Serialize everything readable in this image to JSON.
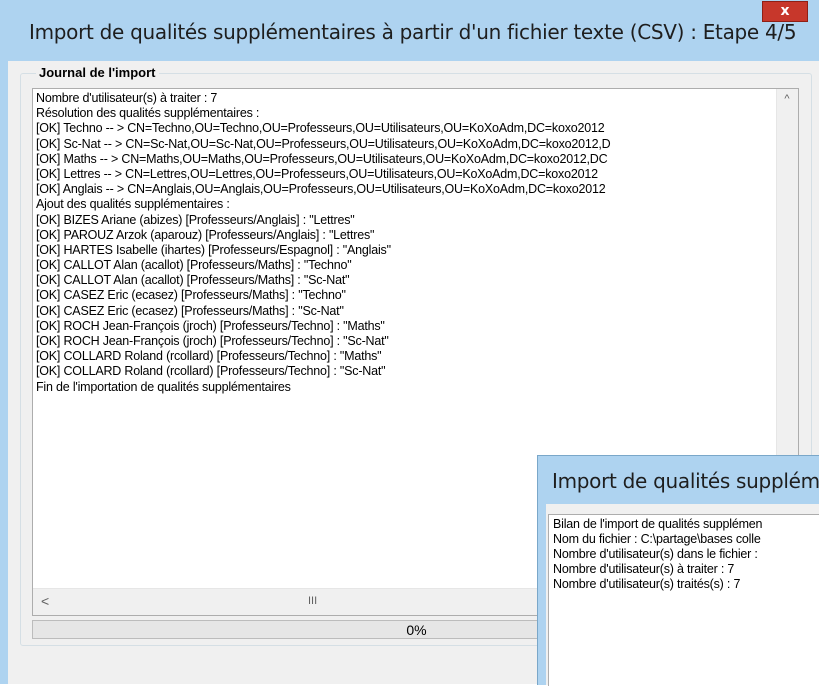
{
  "main_window": {
    "title": "Import de qualités supplémentaires à partir d'un fichier texte (CSV) : Etape 4/5",
    "close_label": "x",
    "group_label": "Journal de l'import",
    "log_lines": [
      "Nombre d'utilisateur(s) à traiter : 7",
      "Résolution des qualités supplémentaires :",
      "[OK] Techno -- > CN=Techno,OU=Techno,OU=Professeurs,OU=Utilisateurs,OU=KoXoAdm,DC=koxo2012",
      "[OK] Sc-Nat -- > CN=Sc-Nat,OU=Sc-Nat,OU=Professeurs,OU=Utilisateurs,OU=KoXoAdm,DC=koxo2012,D",
      "[OK] Maths -- > CN=Maths,OU=Maths,OU=Professeurs,OU=Utilisateurs,OU=KoXoAdm,DC=koxo2012,DC",
      "[OK] Lettres -- > CN=Lettres,OU=Lettres,OU=Professeurs,OU=Utilisateurs,OU=KoXoAdm,DC=koxo2012",
      "[OK] Anglais -- > CN=Anglais,OU=Anglais,OU=Professeurs,OU=Utilisateurs,OU=KoXoAdm,DC=koxo2012",
      "Ajout des qualités supplémentaires :",
      "[OK] BIZES Ariane (abizes) [Professeurs/Anglais]  : \"Lettres\"",
      "[OK] PAROUZ Arzok (aparouz) [Professeurs/Anglais]  : \"Lettres\"",
      "[OK] HARTES Isabelle (ihartes) [Professeurs/Espagnol]  : \"Anglais\"",
      "[OK] CALLOT Alan (acallot) [Professeurs/Maths]  : \"Techno\"",
      "[OK] CALLOT Alan (acallot) [Professeurs/Maths]  : \"Sc-Nat\"",
      "[OK] CASEZ Eric (ecasez) [Professeurs/Maths]  : \"Techno\"",
      "[OK] CASEZ Eric (ecasez) [Professeurs/Maths]  : \"Sc-Nat\"",
      "[OK] ROCH Jean-François (jroch) [Professeurs/Techno]  : \"Maths\"",
      "[OK] ROCH Jean-François (jroch) [Professeurs/Techno]  : \"Sc-Nat\"",
      "[OK] COLLARD Roland (rcollard) [Professeurs/Techno]  : \"Maths\"",
      "[OK] COLLARD Roland (rcollard) [Professeurs/Techno]  : \"Sc-Nat\"",
      "Fin de l'importation de qualités supplémentaires"
    ],
    "scroll_up_glyph": "^",
    "scroll_left_glyph": "<",
    "scroll_grip_glyph": "III",
    "progress_text": "0%",
    "progress_value": 0
  },
  "dialog_window": {
    "title": "Import de qualités suppléme",
    "summary_lines": [
      "Bilan de l'import de qualités supplémen",
      "Nom du fichier : C:\\partage\\bases colle",
      "Nombre d'utilisateur(s) dans le fichier :",
      "Nombre d'utilisateur(s) à traiter : 7",
      "Nombre d'utilisateur(s) traités(s) : 7"
    ]
  },
  "colors": {
    "title_bar": "#aed3f0",
    "close_button": "#c7372b",
    "panel": "#f0f0f0"
  }
}
